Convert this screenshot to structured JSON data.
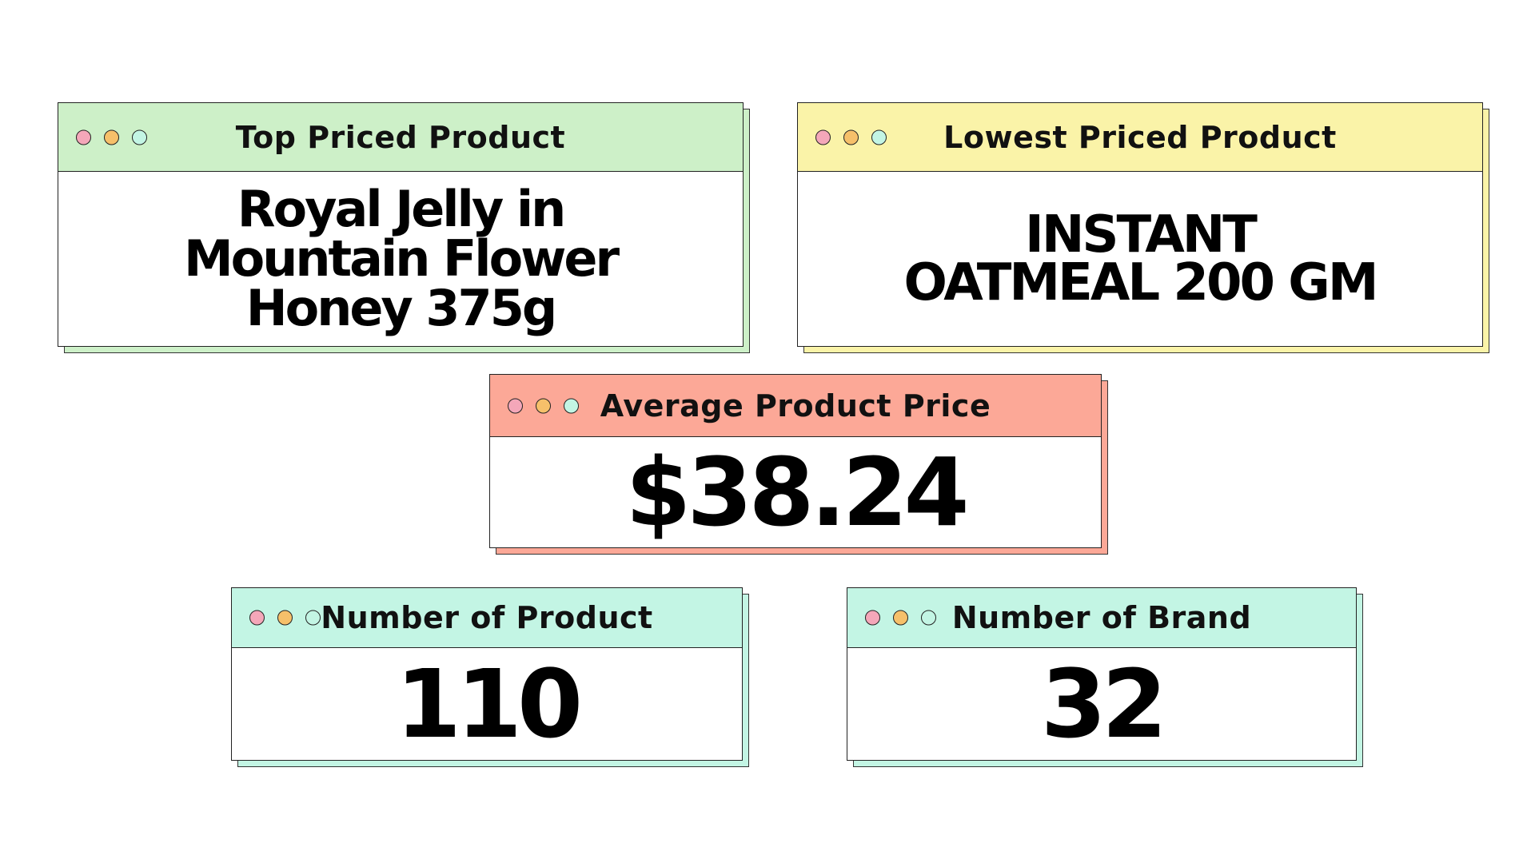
{
  "cards": {
    "top_priced": {
      "title": "Top Priced Product",
      "value": "Royal Jelly in Mountain Flower Honey 375g",
      "color": "#cdf0c8"
    },
    "lowest_priced": {
      "title": "Lowest Priced Product",
      "value": "INSTANT OATMEAL 200 GM",
      "color": "#faf3a8"
    },
    "average_price": {
      "title": "Average Product Price",
      "value": "$38.24",
      "color": "#fca897"
    },
    "number_of_product": {
      "title": "Number of Product",
      "value": "110",
      "color": "#c3f5e4"
    },
    "number_of_brand": {
      "title": "Number of Brand",
      "value": "32",
      "color": "#c3f5e4"
    }
  },
  "window_dots": {
    "colors": [
      "#f4a7b9",
      "#f6c06a",
      "#c3f5e4"
    ],
    "icons": [
      "dot-pink-icon",
      "dot-orange-icon",
      "dot-mint-icon"
    ]
  }
}
